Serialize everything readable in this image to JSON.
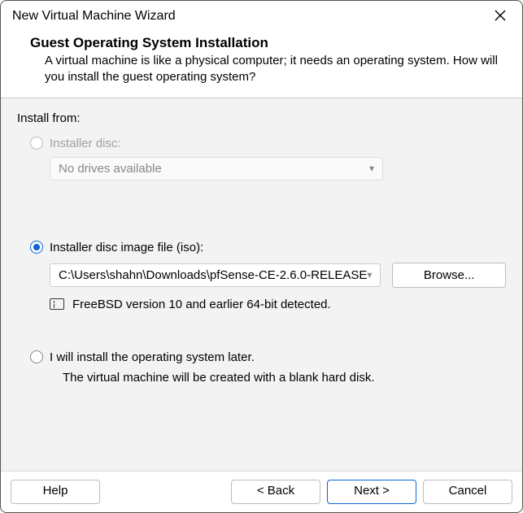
{
  "window": {
    "title": "New Virtual Machine Wizard"
  },
  "header": {
    "title": "Guest Operating System Installation",
    "description": "A virtual machine is like a physical computer; it needs an operating system. How will you install the guest operating system?"
  },
  "content": {
    "install_from_label": "Install from:",
    "opt_disc": {
      "label": "Installer disc:",
      "dropdown_text": "No drives available"
    },
    "opt_iso": {
      "label": "Installer disc image file (iso):",
      "dropdown_text": "C:\\Users\\shahn\\Downloads\\pfSense-CE-2.6.0-RELEASE",
      "browse_label": "Browse...",
      "info_text": "FreeBSD version 10 and earlier 64-bit detected."
    },
    "opt_later": {
      "label": "I will install the operating system later.",
      "sub_text": "The virtual machine will be created with a blank hard disk."
    }
  },
  "footer": {
    "help": "Help",
    "back": "< Back",
    "next": "Next >",
    "cancel": "Cancel"
  }
}
